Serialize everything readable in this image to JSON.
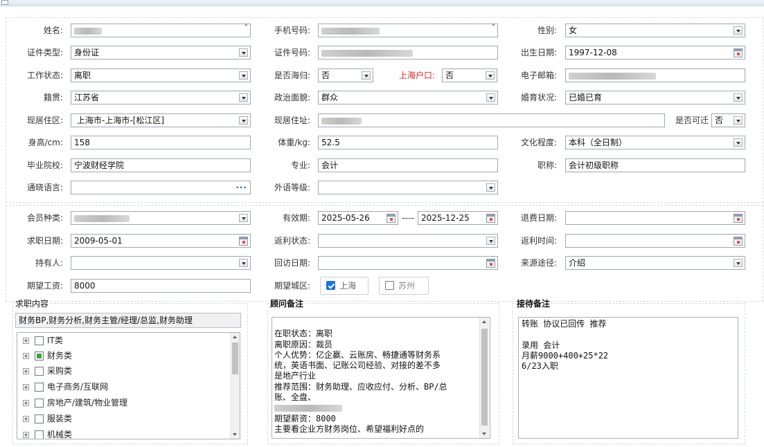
{
  "personal": {
    "name": {
      "label": "姓名:",
      "value": ""
    },
    "phone": {
      "label": "手机号码:",
      "value": ""
    },
    "gender": {
      "label": "性别:",
      "value": "女"
    },
    "id_type": {
      "label": "证件类型:",
      "value": "身份证"
    },
    "id_number": {
      "label": "证件号码:",
      "value": ""
    },
    "birth_date": {
      "label": "出生日期:",
      "value": "1997-12-08"
    },
    "work_status": {
      "label": "工作状态:",
      "value": "离职"
    },
    "returnee": {
      "label": "是否海归:",
      "value": "否"
    },
    "shanghai_hukou": {
      "label": "上海户口:",
      "value": "否"
    },
    "email": {
      "label": "电子邮箱:",
      "value": ""
    },
    "native_place": {
      "label": "籍贯:",
      "value": "江苏省"
    },
    "political": {
      "label": "政治面貌:",
      "value": "群众"
    },
    "marital": {
      "label": "婚育状况:",
      "value": "已婚已育"
    },
    "residence_area": {
      "label": "现居住区:",
      "value": "上海市-上海市-[松江区]"
    },
    "address": {
      "label": "现居住址:",
      "value": ""
    },
    "relocate": {
      "label": "是否可迁",
      "value": "否"
    },
    "height": {
      "label": "身高/cm:",
      "value": "158"
    },
    "weight": {
      "label": "体重/kg:",
      "value": "52.5"
    },
    "education": {
      "label": "文化程度:",
      "value": "本科（全日制）"
    },
    "school": {
      "label": "毕业院校:",
      "value": "宁波财经学院"
    },
    "major": {
      "label": "专业:",
      "value": "会计"
    },
    "title": {
      "label": "职称:",
      "value": "会计初级职称"
    },
    "languages": {
      "label": "通晓语言:",
      "value": ""
    },
    "foreign_level": {
      "label": "外语等级:",
      "value": ""
    }
  },
  "membership": {
    "member_type": {
      "label": "会员种类:",
      "value": ""
    },
    "validity": {
      "label": "有效期:",
      "start": "2025-05-26",
      "separator": "----",
      "end": "2025-12-25"
    },
    "refund_date": {
      "label": "退费日期:",
      "value": ""
    },
    "job_seek_date": {
      "label": "求职日期:",
      "value": "2009-05-01"
    },
    "rebate_status": {
      "label": "返利状态:",
      "value": ""
    },
    "rebate_time": {
      "label": "返利时间:",
      "value": ""
    },
    "holder": {
      "label": "持有人:",
      "value": ""
    },
    "revisit_date": {
      "label": "回访日期:",
      "value": ""
    },
    "source": {
      "label": "来源途径:",
      "value": "介绍"
    },
    "expected_salary": {
      "label": "期望工资:",
      "value": "8000"
    },
    "expected_city": {
      "label": "期望城区:",
      "options": [
        {
          "label": "上海",
          "checked": true
        },
        {
          "label": "苏州",
          "checked": false
        }
      ]
    }
  },
  "job_content": {
    "legend": "求职内容",
    "summary": "财务BP,财务分析,财务主管/经理/总监,财务助理",
    "tree": [
      {
        "label": "IT类",
        "state": "none"
      },
      {
        "label": "财务类",
        "state": "partial"
      },
      {
        "label": "采购类",
        "state": "none"
      },
      {
        "label": "电子商务/互联网",
        "state": "none"
      },
      {
        "label": "房地产/建筑/物业管理",
        "state": "none"
      },
      {
        "label": "服装类",
        "state": "none"
      },
      {
        "label": "机械类",
        "state": "none"
      }
    ]
  },
  "advisor_notes": {
    "legend": "顾问备注",
    "lines": [
      "",
      "在职状态：离职",
      "离职原因：裁员",
      "个人优势：亿企赢、云账房、畅捷通等财务系",
      "统，英语书面、记账公司经验、对接的差不多",
      "是地产行业",
      "推荐范围：财务助理、应收应付、分析、BP/总",
      "账、全盘、",
      "",
      "期望薪资：8000",
      "主要看企业方财务岗位、希望福利好点的"
    ]
  },
  "reception_notes": {
    "legend": "接待备注",
    "lines": [
      "      转账   协议已回传      推荐",
      "",
      "    录用  会计",
      "月薪9000+400+25*22",
      "6/23入职"
    ]
  }
}
